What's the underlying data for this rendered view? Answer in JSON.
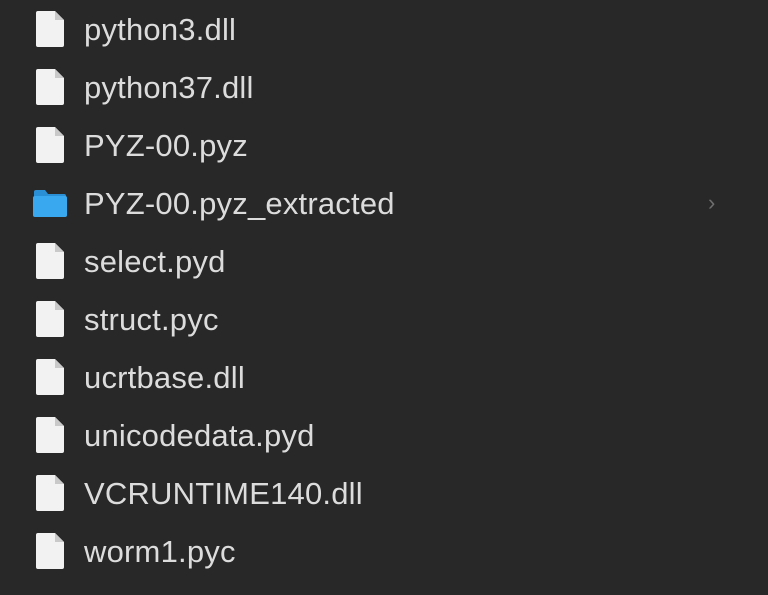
{
  "files": [
    {
      "name": "python3.dll",
      "kind": "file",
      "icon": "document-icon"
    },
    {
      "name": "python37.dll",
      "kind": "file",
      "icon": "document-icon"
    },
    {
      "name": "PYZ-00.pyz",
      "kind": "file",
      "icon": "document-icon"
    },
    {
      "name": "PYZ-00.pyz_extracted",
      "kind": "folder",
      "icon": "folder-icon",
      "chevron": "›"
    },
    {
      "name": "select.pyd",
      "kind": "file",
      "icon": "document-icon"
    },
    {
      "name": "struct.pyc",
      "kind": "file",
      "icon": "document-icon"
    },
    {
      "name": "ucrtbase.dll",
      "kind": "file",
      "icon": "document-icon"
    },
    {
      "name": "unicodedata.pyd",
      "kind": "file",
      "icon": "document-icon"
    },
    {
      "name": "VCRUNTIME140.dll",
      "kind": "file",
      "icon": "document-icon"
    },
    {
      "name": "worm1.pyc",
      "kind": "file",
      "icon": "document-icon"
    }
  ],
  "colors": {
    "background": "#282828",
    "text": "#dcdcdc",
    "document": "#f2f2f2",
    "folder": "#3aa8ef",
    "chevron": "#6e6e6e"
  }
}
